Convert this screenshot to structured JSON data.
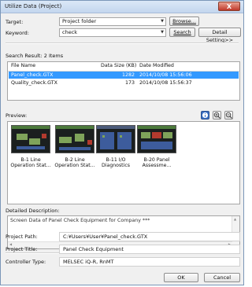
{
  "window": {
    "title": "Utilize Data (Project)",
    "close_symbol": "X"
  },
  "form": {
    "target_label": "Target:",
    "target_value": "Project folder",
    "browse_label": "Browse...",
    "keyword_label": "Keyword:",
    "keyword_value": "check",
    "search_label": "Search",
    "detail_label": "Detail Setting>>"
  },
  "results": {
    "label": "Search Result: 2 Items",
    "columns": [
      "File Name",
      "Data Size (KB)",
      "Date Modified"
    ],
    "rows": [
      {
        "name": "Panel_check.GTX",
        "size": "1282",
        "date": "2014/10/08 15:56:06"
      },
      {
        "name": "Quality_check.GTX",
        "size": "173",
        "date": "2014/10/08 15:56:37"
      }
    ]
  },
  "preview": {
    "label": "Preview:",
    "items": [
      {
        "line1": "B-1 Line",
        "line2": "Operation Stat..."
      },
      {
        "line1": "B-2 Line",
        "line2": "Operation Stat..."
      },
      {
        "line1": "B-11 I/O",
        "line2": "Diagnostics"
      },
      {
        "line1": "B-20 Panel",
        "line2": "Assessme..."
      }
    ]
  },
  "description": {
    "label": "Detailed Description:",
    "text": "Screen Data of Panel Check Equipment for Company ***"
  },
  "info": {
    "path_label": "Project Path:",
    "path_value": "C:¥Users¥User¥Panel_check.GTX",
    "title_label": "Project Title:",
    "title_value": "Panel Check Equipment",
    "controller_label": "Controller Type:",
    "controller_value": "MELSEC iQ-R, RnMT"
  },
  "footer": {
    "ok_label": "OK",
    "cancel_label": "Cancel"
  }
}
